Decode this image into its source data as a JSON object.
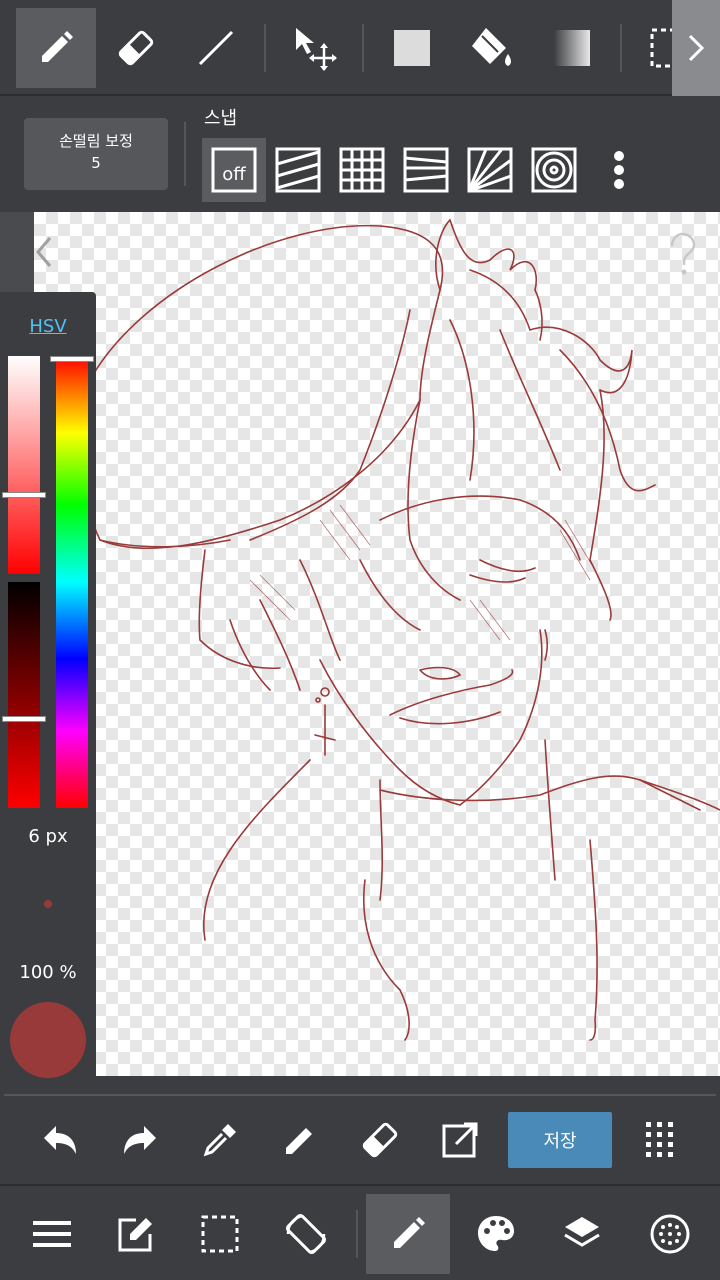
{
  "toolbar": {
    "tools": [
      "pen-tool",
      "eraser-tool",
      "line-tool",
      "move-tool",
      "shape-tool",
      "fill-tool",
      "gradient-tool",
      "select-tool"
    ]
  },
  "stabilizer": {
    "label": "손떨림 보정",
    "value": "5"
  },
  "snap": {
    "label": "스냅",
    "off_label": "off",
    "options": [
      "off",
      "parallel",
      "grid",
      "perspective",
      "radial",
      "concentric"
    ]
  },
  "color_panel": {
    "mode_label": "HSV",
    "brush_size": "6 px",
    "opacity": "100 %",
    "current_color": "#993a3a"
  },
  "bottom_actions": {
    "save_label": "저장"
  },
  "colors": {
    "toolbar_bg": "#3c3d40",
    "accent": "#4a8ab8",
    "stroke": "#9a3a3a"
  }
}
